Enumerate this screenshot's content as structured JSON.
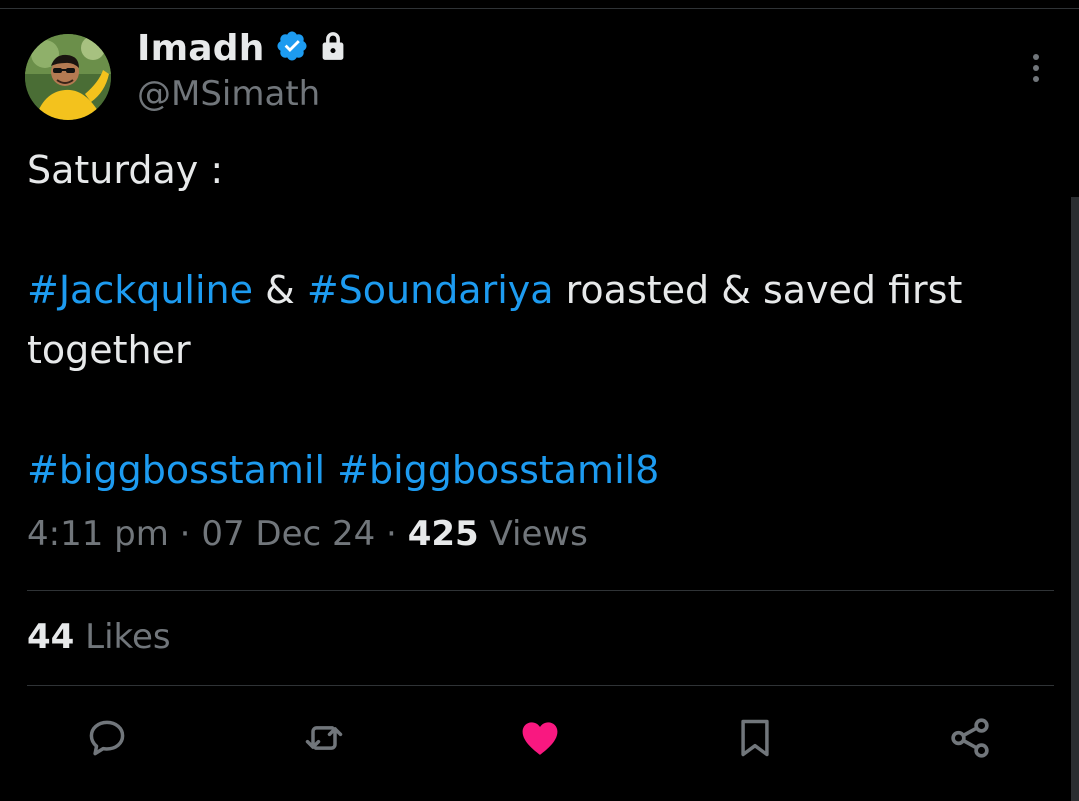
{
  "tweet": {
    "author": {
      "name": "Imadh",
      "handle": "@MSimath",
      "verified_color": "#1d9bf0",
      "verified_icon": "verified-badge-icon",
      "protected_icon": "lock-icon"
    },
    "body": {
      "line1": "Saturday :",
      "line2": {
        "tag1": "#Jackquline",
        "amp": " & ",
        "tag2": "#Soundariya",
        "rest": " roasted & saved first"
      },
      "line3": "together",
      "line4": {
        "tag1": "#biggbosstamil",
        "space": " ",
        "tag2": "#biggbosstamil8"
      }
    },
    "meta": {
      "time": "4:11 pm",
      "sep1": " · ",
      "date": "07 Dec 24",
      "sep2": " · ",
      "views_count": "425",
      "views_label": " Views"
    },
    "stats": {
      "likes_count": "44",
      "likes_label": " Likes"
    },
    "actions": [
      {
        "name": "reply",
        "icon": "reply-icon"
      },
      {
        "name": "repost",
        "icon": "repost-icon"
      },
      {
        "name": "like",
        "icon": "heart-icon",
        "active": true,
        "color": "#f91880"
      },
      {
        "name": "bookmark",
        "icon": "bookmark-icon"
      },
      {
        "name": "share",
        "icon": "share-icon"
      }
    ]
  },
  "colors": {
    "background": "#000000",
    "text_primary": "#e7e9ea",
    "text_secondary": "#71767b",
    "link": "#1d9bf0",
    "like": "#f91880",
    "divider": "#2f3336"
  }
}
